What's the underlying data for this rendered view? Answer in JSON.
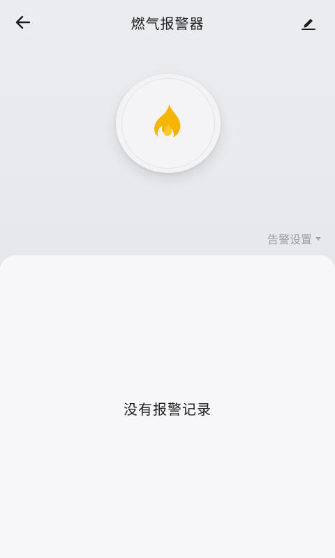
{
  "header": {
    "title": "燃气报警器",
    "back_icon": "arrow-left-icon",
    "edit_icon": "pencil-icon"
  },
  "device": {
    "icon": "flame-icon",
    "icon_color": "#f5b400"
  },
  "alarm_settings": {
    "label": "告警设置",
    "icon": "caret-down-icon"
  },
  "records": {
    "empty_message": "没有报警记录"
  }
}
